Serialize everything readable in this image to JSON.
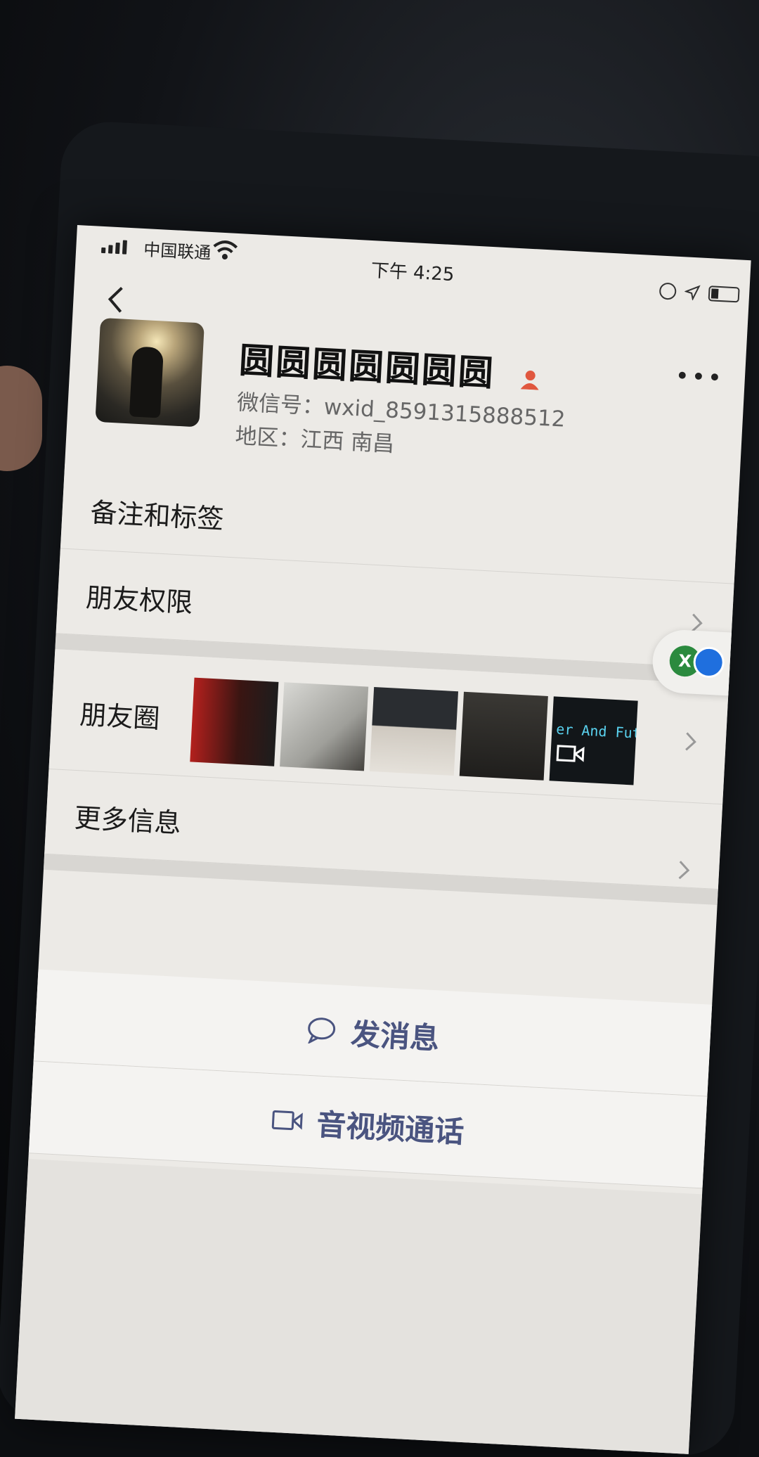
{
  "status_bar": {
    "carrier": "中国联通",
    "time": "下午 4:25"
  },
  "profile": {
    "nickname": "圆圆圆圆圆圆圆",
    "wechat_id": "微信号：wxid_8591315888512",
    "region": "地区：江西 南昌"
  },
  "menu": {
    "remarks_label": "备注和标签",
    "permissions_label": "朋友权限",
    "moments_label": "朋友圈",
    "more_info_label": "更多信息"
  },
  "moments": {
    "video_thumb_text": "er And Fut"
  },
  "floating": {
    "green_badge": "X"
  },
  "actions": {
    "send_message": "发消息",
    "video_call": "音视频通话"
  },
  "colors": {
    "action_text": "#4a5480",
    "background": "#eceae6"
  }
}
